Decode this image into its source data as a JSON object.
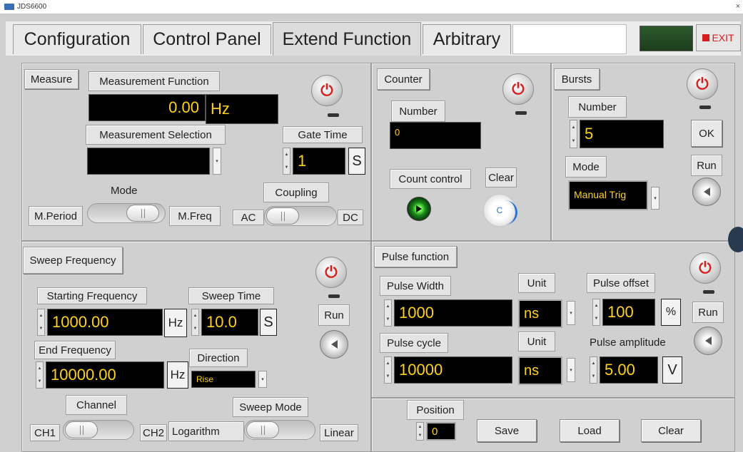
{
  "window": {
    "title": "JDS6600"
  },
  "tabs": [
    "Configuration",
    "Control Panel",
    "Extend Function",
    "Arbitrary"
  ],
  "exit_label": "EXIT",
  "measure": {
    "title": "Measure",
    "function_label": "Measurement Function",
    "value": "0.00",
    "unit": "Hz",
    "selection_label": "Measurement Selection",
    "selection_value": "",
    "gate_label": "Gate Time",
    "gate_value": "1",
    "gate_unit": "S",
    "mode_label": "Mode",
    "mode_left": "M.Period",
    "mode_right": "M.Freq",
    "coupling_label": "Coupling",
    "coupling_left": "AC",
    "coupling_right": "DC"
  },
  "counter": {
    "title": "Counter",
    "number_label": "Number",
    "number_value": "0",
    "count_control_label": "Count control",
    "clear_label": "Clear",
    "clear_glyph": "C"
  },
  "bursts": {
    "title": "Bursts",
    "number_label": "Number",
    "number_value": "5",
    "ok_label": "OK",
    "mode_label": "Mode",
    "mode_value": "Manual Trig",
    "run_label": "Run"
  },
  "sweep": {
    "title": "Sweep Frequency",
    "start_label": "Starting Frequency",
    "start_value": "1000.00",
    "start_unit": "Hz",
    "time_label": "Sweep Time",
    "time_value": "10.0",
    "time_unit": "S",
    "run_label": "Run",
    "end_label": "End Frequency",
    "end_value": "10000.00",
    "end_unit": "Hz",
    "direction_label": "Direction",
    "direction_value": "Rise",
    "channel_label": "Channel",
    "ch1": "CH1",
    "ch2": "CH2",
    "mode_label": "Sweep Mode",
    "mode_left": "Logarithm",
    "mode_right": "Linear"
  },
  "pulse": {
    "title": "Pulse function",
    "width_label": "Pulse Width",
    "width_value": "1000",
    "unit_label": "Unit",
    "width_unit": "ns",
    "offset_label": "Pulse offset",
    "offset_value": "100",
    "offset_unit": "%",
    "run_label": "Run",
    "cycle_label": "Pulse cycle",
    "cycle_value": "10000",
    "unit_label2": "Unit",
    "cycle_unit": "ns",
    "amp_label": "Pulse amplitude",
    "amp_value": "5.00",
    "amp_unit": "V"
  },
  "bottom": {
    "position_label": "Position",
    "position_value": "0",
    "save": "Save",
    "load": "Load",
    "clear": "Clear"
  }
}
